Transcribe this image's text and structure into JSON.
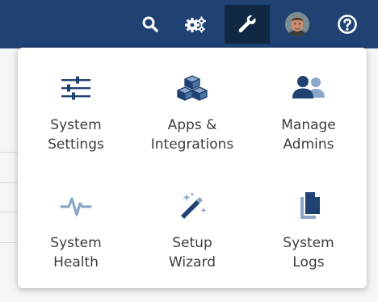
{
  "topbar": {
    "color": "#1f4273",
    "active_color": "#112843",
    "buttons": [
      {
        "name": "search",
        "icon": "search-icon"
      },
      {
        "name": "integrations",
        "icon": "gears-icon"
      },
      {
        "name": "admin-tools",
        "icon": "wrench-icon",
        "active": true
      },
      {
        "name": "profile",
        "icon": "avatar"
      },
      {
        "name": "help",
        "icon": "help-circle-icon"
      }
    ]
  },
  "menu": {
    "icon_color": "#1f4273",
    "items": [
      {
        "id": "system-settings",
        "icon": "sliders-icon",
        "line1": "System",
        "line2": "Settings"
      },
      {
        "id": "apps-integrations",
        "icon": "cubes-icon",
        "line1": "Apps &",
        "line2": "Integrations"
      },
      {
        "id": "manage-admins",
        "icon": "users-icon",
        "line1": "Manage",
        "line2": "Admins"
      },
      {
        "id": "system-health",
        "icon": "heartbeat-icon",
        "line1": "System",
        "line2": "Health"
      },
      {
        "id": "setup-wizard",
        "icon": "magic-wand-icon",
        "line1": "Setup",
        "line2": "Wizard"
      },
      {
        "id": "system-logs",
        "icon": "documents-icon",
        "line1": "System",
        "line2": "Logs"
      }
    ]
  }
}
